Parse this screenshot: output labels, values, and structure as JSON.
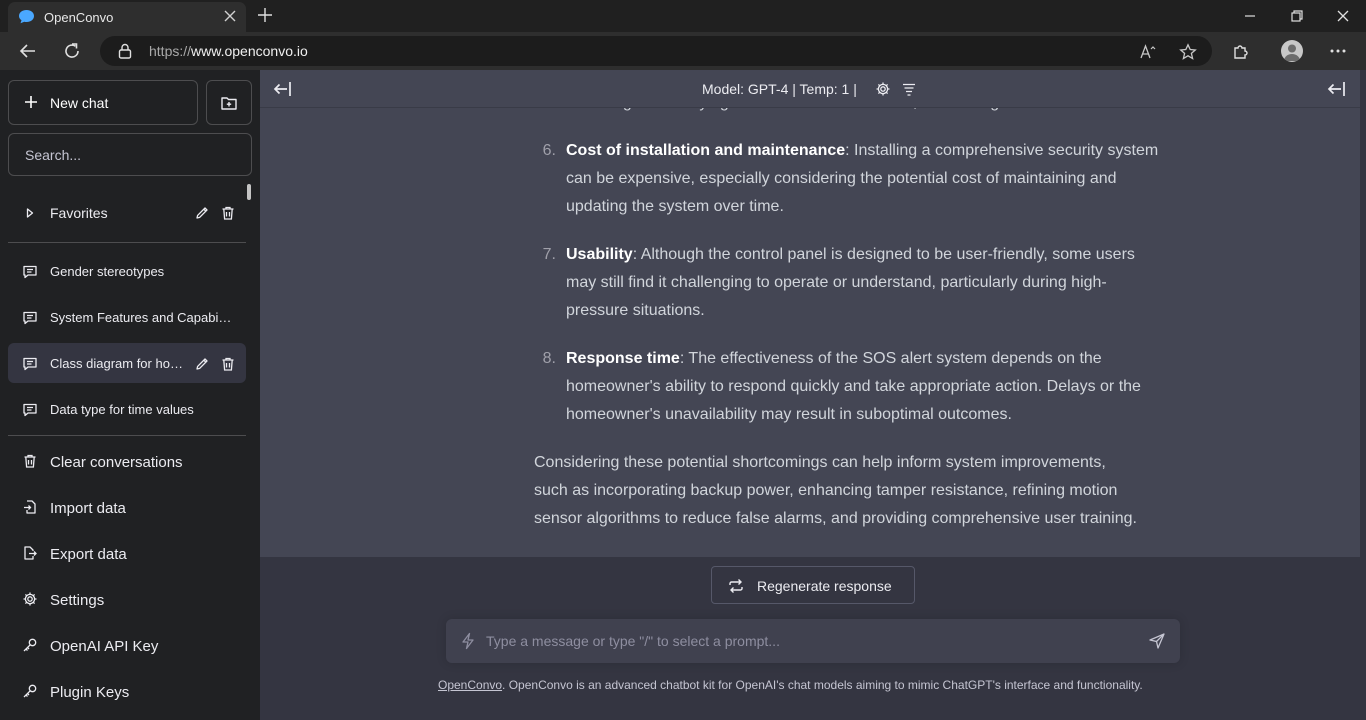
{
  "browser": {
    "tab_title": "OpenConvo",
    "url_protocol": "https://",
    "url_host": "www.openconvo.io"
  },
  "sidebar": {
    "new_chat_label": "New chat",
    "search_placeholder": "Search...",
    "folders": [
      {
        "label": "Favorites"
      }
    ],
    "conversations": [
      {
        "label": "Gender stereotypes"
      },
      {
        "label": "System Features and Capabilities"
      },
      {
        "label": "Class diagram for home security"
      },
      {
        "label": "Data type for time values"
      }
    ],
    "actions": [
      {
        "label": "Clear conversations",
        "icon": "trash-icon"
      },
      {
        "label": "Import data",
        "icon": "file-import-icon"
      },
      {
        "label": "Export data",
        "icon": "file-export-icon"
      },
      {
        "label": "Settings",
        "icon": "gear-icon"
      },
      {
        "label": "OpenAI API Key",
        "icon": "key-icon"
      },
      {
        "label": "Plugin Keys",
        "icon": "key-icon"
      }
    ]
  },
  "header": {
    "model_info": "Model: GPT-4 | Temp: 1 |"
  },
  "chat": {
    "partial_previous_line": "removing or destroying the sensors and cameras, or blocking their view.",
    "list_items": [
      {
        "number": "6.",
        "title": "Cost of installation and maintenance",
        "lines": [
          ": Installing a comprehensive security system",
          "can be expensive, especially considering the potential cost of maintaining and",
          "updating the system over time."
        ]
      },
      {
        "number": "7.",
        "title": "Usability",
        "lines": [
          ": Although the control panel is designed to be user-friendly, some users",
          "may still find it challenging to operate or understand, particularly during high-",
          "pressure situations."
        ]
      },
      {
        "number": "8.",
        "title": "Response time",
        "lines": [
          ": The effectiveness of the SOS alert system depends on the",
          "homeowner's ability to respond quickly and take appropriate action. Delays or the",
          "homeowner's unavailability may result in suboptimal outcomes."
        ]
      }
    ],
    "closing_lines": [
      "Considering these potential shortcomings can help inform system improvements,",
      "such as incorporating backup power, enhancing tamper resistance, refining motion",
      "sensor algorithms to reduce false alarms, and providing comprehensive user training."
    ]
  },
  "regenerate_label": "Regenerate response",
  "composer": {
    "placeholder": "Type a message or type \"/\" to select a prompt..."
  },
  "footer": {
    "link_text": "OpenConvo",
    "text": ". OpenConvo is an advanced chatbot kit for OpenAI's chat models aiming to mimic ChatGPT's interface and functionality."
  },
  "colors": {
    "sidebar_bg": "#202123",
    "main_bg": "#343541",
    "message_bg": "#444654",
    "composer_bg": "#40414f"
  }
}
